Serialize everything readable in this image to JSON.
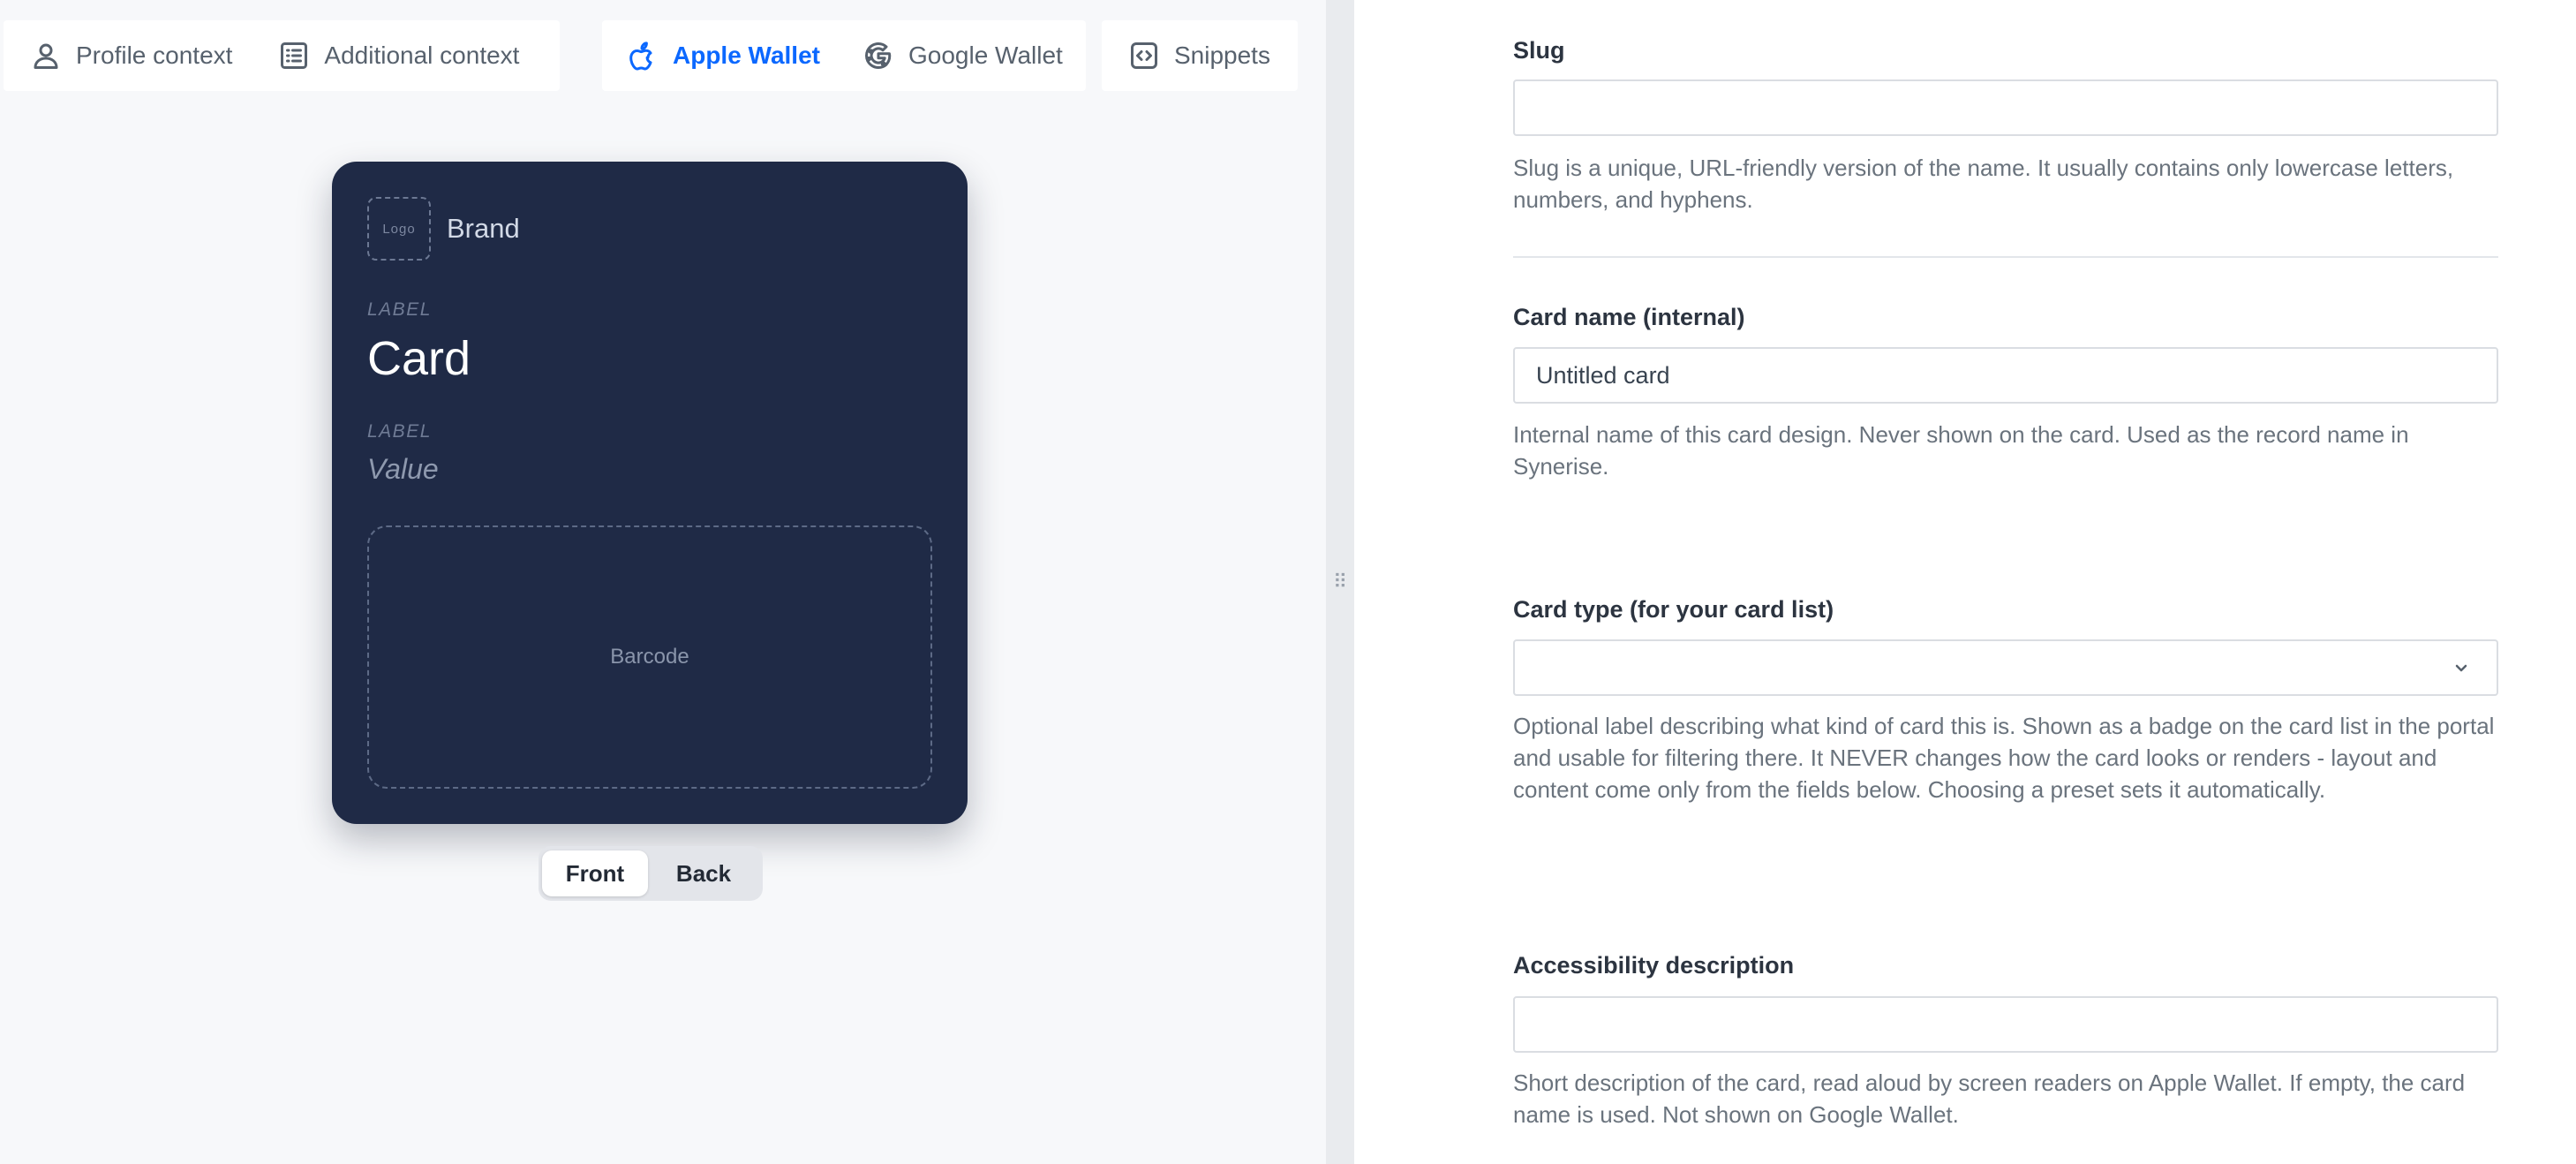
{
  "toolbar": {
    "profile_context": {
      "label": "Profile context",
      "icon": "user-icon"
    },
    "additional_context": {
      "label": "Additional context",
      "icon": "list-icon"
    },
    "apple_wallet": {
      "label": "Apple Wallet",
      "icon": "apple-icon",
      "active": true
    },
    "google_wallet": {
      "label": "Google Wallet",
      "icon": "google-icon"
    },
    "snippets": {
      "label": "Snippets",
      "icon": "code-icon"
    }
  },
  "card_preview": {
    "logo_placeholder": "Logo",
    "brand": "Brand",
    "primary_label": "LABEL",
    "primary_value": "Card",
    "secondary_label": "LABEL",
    "secondary_value": "Value",
    "barcode_placeholder": "Barcode",
    "background_color": "#1f2a46"
  },
  "side_toggle": {
    "front": "Front",
    "back": "Back",
    "selected": "Front"
  },
  "form": {
    "slug": {
      "label": "Slug",
      "value": "",
      "help": "Slug is a unique, URL-friendly version of the name. It usually contains only lowercase letters, numbers, and hyphens."
    },
    "card_name": {
      "label": "Card name (internal)",
      "value": "Untitled card",
      "help": "Internal name of this card design. Never shown on the card. Used as the record name in Synerise."
    },
    "card_type": {
      "label": "Card type (for your card list)",
      "value": "",
      "help": "Optional label describing what kind of card this is. Shown as a badge on the card list in the portal and usable for filtering there. It NEVER changes how the card looks or renders - layout and content come only from the fields below. Choosing a preset sets it automatically."
    },
    "accessibility": {
      "label": "Accessibility description",
      "value": "",
      "help": "Short description of the card, read aloud by screen readers on Apple Wallet. If empty, the card name is used. Not shown on Google Wallet."
    }
  },
  "colors": {
    "accent": "#0b68ff",
    "card_bg": "#1f2a46",
    "preview_bg": "#f7f8fa"
  }
}
